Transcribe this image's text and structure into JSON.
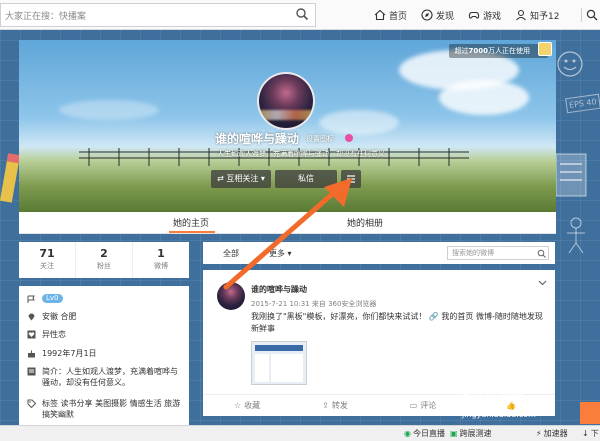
{
  "browser": {
    "search_placeholder": "大家正在搜：快播案"
  },
  "nav": {
    "home": "首页",
    "discover": "发现",
    "games": "游戏",
    "user": "知予12"
  },
  "banner": {
    "users_prefix": "超过",
    "users_bold": "7000",
    "users_suffix": "万人正在使用",
    "username": "谁的喧哗与躁动",
    "v_setting": "设置图标",
    "bio": "人生如观人渡梦，充满着喧哗与骚动，却没有任何意义。",
    "follow_btn": "互相关注",
    "message_btn": "私信"
  },
  "tabs": {
    "home": "她的主页",
    "album": "她的相册"
  },
  "stats": [
    {
      "num": "71",
      "label": "关注"
    },
    {
      "num": "2",
      "label": "粉丝"
    },
    {
      "num": "1",
      "label": "微博"
    }
  ],
  "info": {
    "level": "Lv0",
    "location": "安徽 合肥",
    "orientation": "异性恋",
    "birthday": "1992年7月1日",
    "intro": "简介：人生如观人渡梦，充满着喧哗与骚动，却没有任何意义。",
    "tags": "标签  读书分享 美图摄影 情感生活 旅游 搞笑幽默"
  },
  "feed": {
    "all": "全部",
    "more": "更多",
    "search_placeholder": "搜索她的微博"
  },
  "post": {
    "author": "谁的喧哗与躁动",
    "meta": "2015-7-21 10:31 来自 360安全浏览器",
    "text": "我刚换了\"黑板\"模板，好漂亮，你们都快来试试！",
    "link": "我的首页 微博-随时随地发现新鲜事",
    "favorite": "收藏",
    "repost": "转发",
    "comment": "评论"
  },
  "bottom": {
    "today_live": "今日直播",
    "accelerator": "加速器",
    "download": "下",
    "speedtest": "跨展测速"
  },
  "watermark": {
    "brand": "Baidu 经验",
    "url": "jingyan.baidu.com"
  },
  "decorations": {
    "eps": "EPS 40"
  }
}
